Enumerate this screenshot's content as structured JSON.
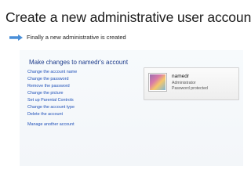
{
  "slide": {
    "title": "Create a new administrative user account",
    "subtitle": "Finally a new administrative is created"
  },
  "panel": {
    "title": "Make changes to namedr's account",
    "links": [
      "Change the account name",
      "Change the password",
      "Remove the password",
      "Change the picture",
      "Set up Parental Controls",
      "Change the account type",
      "Delete the account"
    ],
    "manage_link": "Manage another account"
  },
  "account_card": {
    "name": "namedr",
    "type": "Administrator",
    "status": "Password protected"
  },
  "colors": {
    "title_blue": "#1e3d8c",
    "link_blue": "#1f50b8",
    "arrow_blue": "#4a8fd8"
  }
}
